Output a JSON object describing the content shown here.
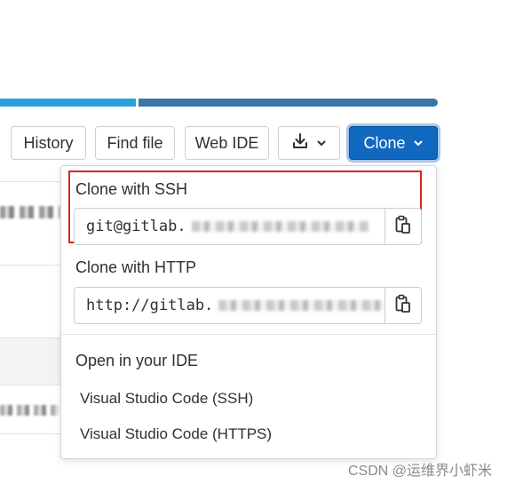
{
  "toolbar": {
    "history_label": "History",
    "find_file_label": "Find file",
    "web_ide_label": "Web IDE",
    "clone_label": "Clone"
  },
  "colors": {
    "primary_button": "#1068bf",
    "language_bar_1": "#2aa1d8",
    "language_bar_2": "#3877a8",
    "highlight_box": "#d62424"
  },
  "icons": {
    "download": "download-icon",
    "chevron": "chevron-down-icon",
    "copy": "copy-to-clipboard-icon"
  },
  "clone_dropdown": {
    "ssh": {
      "title": "Clone with SSH",
      "url_prefix": "git@gitlab."
    },
    "http": {
      "title": "Clone with HTTP",
      "url_prefix": "http://gitlab."
    },
    "ide": {
      "title": "Open in your IDE",
      "items": [
        "Visual Studio Code (SSH)",
        "Visual Studio Code (HTTPS)"
      ]
    }
  },
  "watermark": "CSDN @运维界小虾米"
}
